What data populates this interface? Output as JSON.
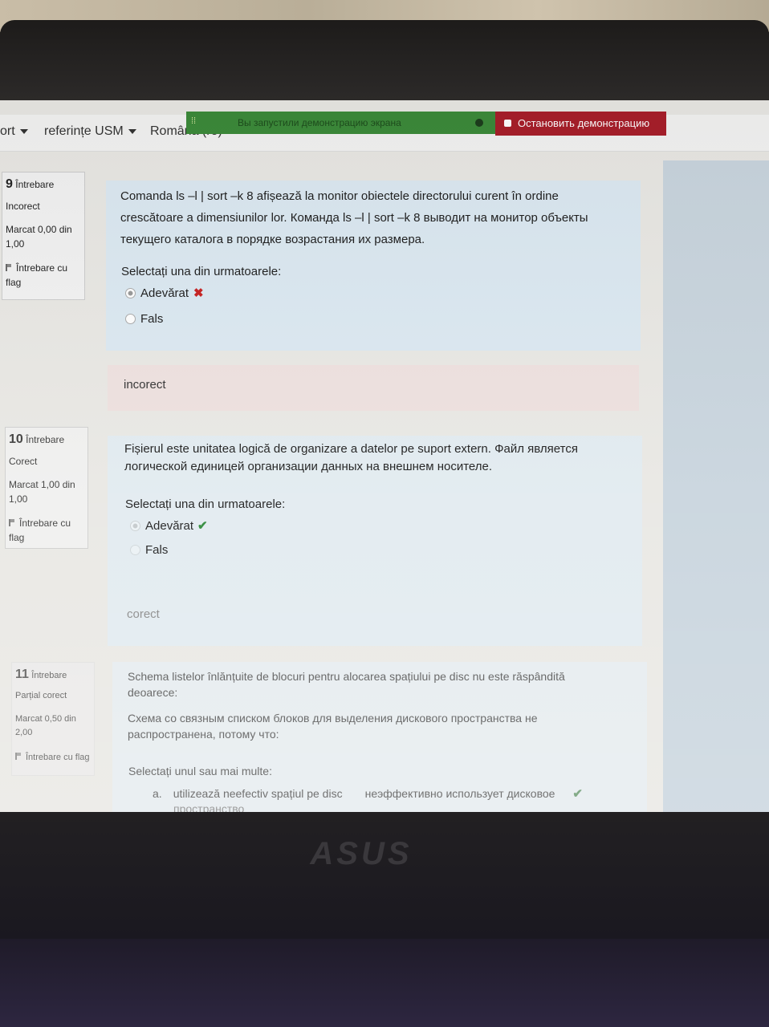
{
  "screen_share": {
    "notice": "Вы запустили демонстрацию экрана",
    "stop_label": "Остановить демонстрацию"
  },
  "nav": {
    "items": [
      "ort",
      "referințe USM",
      "Română (ro)"
    ]
  },
  "brand": "ASUS",
  "questions": [
    {
      "number": "9",
      "number_label": "Întrebare",
      "state": "Incorect",
      "grade": "Marcat 0,00 din 1,00",
      "flag": "Întrebare cu flag",
      "text_line1": "Comanda    ls –l  | sort –k 8  afișează la monitor obiectele directorului curent în ordine",
      "text_line2": "crescătoare a dimensiunilor lor.   Команда ls –l  | sort –k 8 выводит на монитор объекты",
      "text_line3": "текущего каталога в порядке возрастания их размера.",
      "prompt": "Selectați una din urmatoarele:",
      "options": [
        {
          "label": "Adevărat",
          "selected": true,
          "mark": "✖"
        },
        {
          "label": "Fals",
          "selected": false,
          "mark": ""
        }
      ],
      "feedback": "incorect"
    },
    {
      "number": "10",
      "number_label": "Întrebare",
      "state": "Corect",
      "grade": "Marcat 1,00 din 1,00",
      "flag": "Întrebare cu flag",
      "text_line1": "Fișierul este unitatea logică de organizare a datelor pe suport extern.     Файл является",
      "text_line2": "логической единицей организации данных на внешнем носителе.",
      "prompt": "Selectați una din urmatoarele:",
      "options": [
        {
          "label": "Adevărat",
          "selected": true,
          "mark": "✔"
        },
        {
          "label": "Fals",
          "selected": false,
          "mark": ""
        }
      ],
      "feedback": "corect"
    },
    {
      "number": "11",
      "number_label": "Întrebare",
      "state": "Parțial corect",
      "grade": "Marcat 0,50 din 2,00",
      "flag": "Întrebare cu flag",
      "text_line1": "Schema listelor înlănțuite de blocuri pentru alocarea spațiului pe disc nu este răspândită",
      "text_line2": "deoarece:",
      "text_line3": "Схема со связным списком блоков для выделения дискового пространства не",
      "text_line4": "распространена, потому что:",
      "prompt": "Selectați unul sau mai multe:",
      "option_a_letter": "a.",
      "option_a_ro": "utilizează neefectiv spațiul pe disc",
      "option_a_ru": "неэффективно использует дисковое",
      "option_a_ru2": "пространство",
      "option_a_mark": "✔"
    }
  ]
}
